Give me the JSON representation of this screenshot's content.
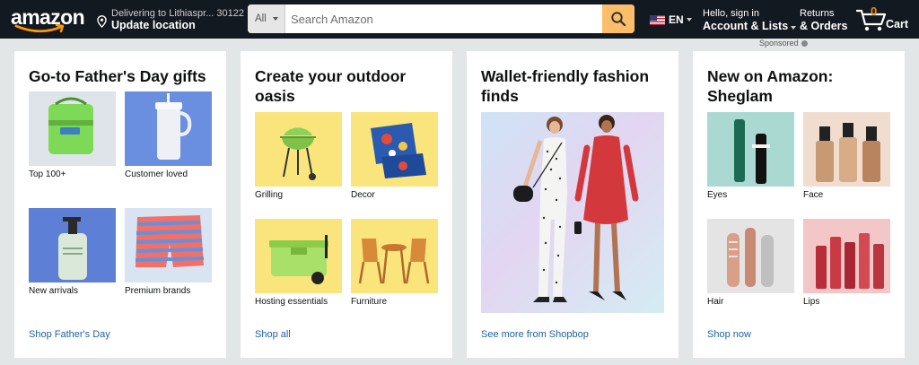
{
  "nav": {
    "logo": "amazon",
    "deliver_line1": "Delivering to Lithiaspr... 30122",
    "deliver_line2": "Update location",
    "search_category": "All",
    "search_placeholder": "Search Amazon",
    "language": "EN",
    "account_line1": "Hello, sign in",
    "account_line2": "Account & Lists",
    "returns_line1": "Returns",
    "returns_line2": "& Orders",
    "cart_count": "0",
    "cart_label": "Cart",
    "sponsored": "Sponsored"
  },
  "cards": [
    {
      "title": "Go-to Father's Day gifts",
      "tiles": [
        {
          "caption": "Top 100+"
        },
        {
          "caption": "Customer loved"
        },
        {
          "caption": "New arrivals"
        },
        {
          "caption": "Premium brands"
        }
      ],
      "link": "Shop Father's Day"
    },
    {
      "title": "Create your outdoor oasis",
      "tiles": [
        {
          "caption": "Grilling"
        },
        {
          "caption": "Decor"
        },
        {
          "caption": "Hosting essentials"
        },
        {
          "caption": "Furniture"
        }
      ],
      "link": "Shop all"
    },
    {
      "title": "Wallet-friendly fashion finds",
      "link": "See more from Shopbop"
    },
    {
      "title": "New on Amazon: Sheglam",
      "tiles": [
        {
          "caption": "Eyes"
        },
        {
          "caption": "Face"
        },
        {
          "caption": "Hair"
        },
        {
          "caption": "Lips"
        }
      ],
      "link": "Shop now"
    }
  ],
  "colors": {
    "nav_bg": "#131921",
    "search_button": "#febd69",
    "cart_count": "#f08804",
    "link": "#2162a1",
    "page_bg": "#e3e6e6"
  },
  "icons": [
    "location-pin-icon",
    "search-icon",
    "us-flag-icon",
    "cart-icon",
    "info-icon"
  ]
}
